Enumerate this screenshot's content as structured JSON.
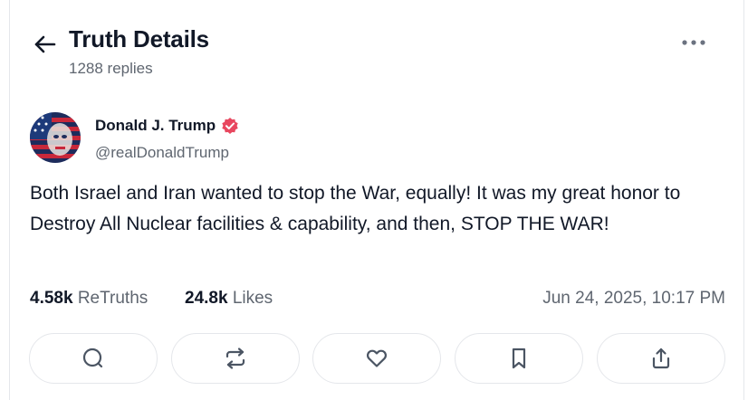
{
  "header": {
    "title": "Truth Details",
    "replies": "1288 replies",
    "back_icon": "arrow-left-icon",
    "more_icon": "ellipsis-icon"
  },
  "post": {
    "author_name": "Donald J. Trump",
    "author_handle": "@realDonaldTrump",
    "verified_color": "#e8475f",
    "text": "Both Israel and Iran wanted to stop the War, equally! It was my great honor to Destroy All Nuclear facilities & capability, and then, STOP THE WAR!",
    "retruths_count": "4.58k",
    "retruths_label": "ReTruths",
    "likes_count": "24.8k",
    "likes_label": "Likes",
    "timestamp": "Jun 24, 2025, 10:17 PM"
  },
  "actions": [
    {
      "icon": "reply-icon"
    },
    {
      "icon": "retruth-icon"
    },
    {
      "icon": "like-icon"
    },
    {
      "icon": "bookmark-icon"
    },
    {
      "icon": "share-icon"
    }
  ]
}
